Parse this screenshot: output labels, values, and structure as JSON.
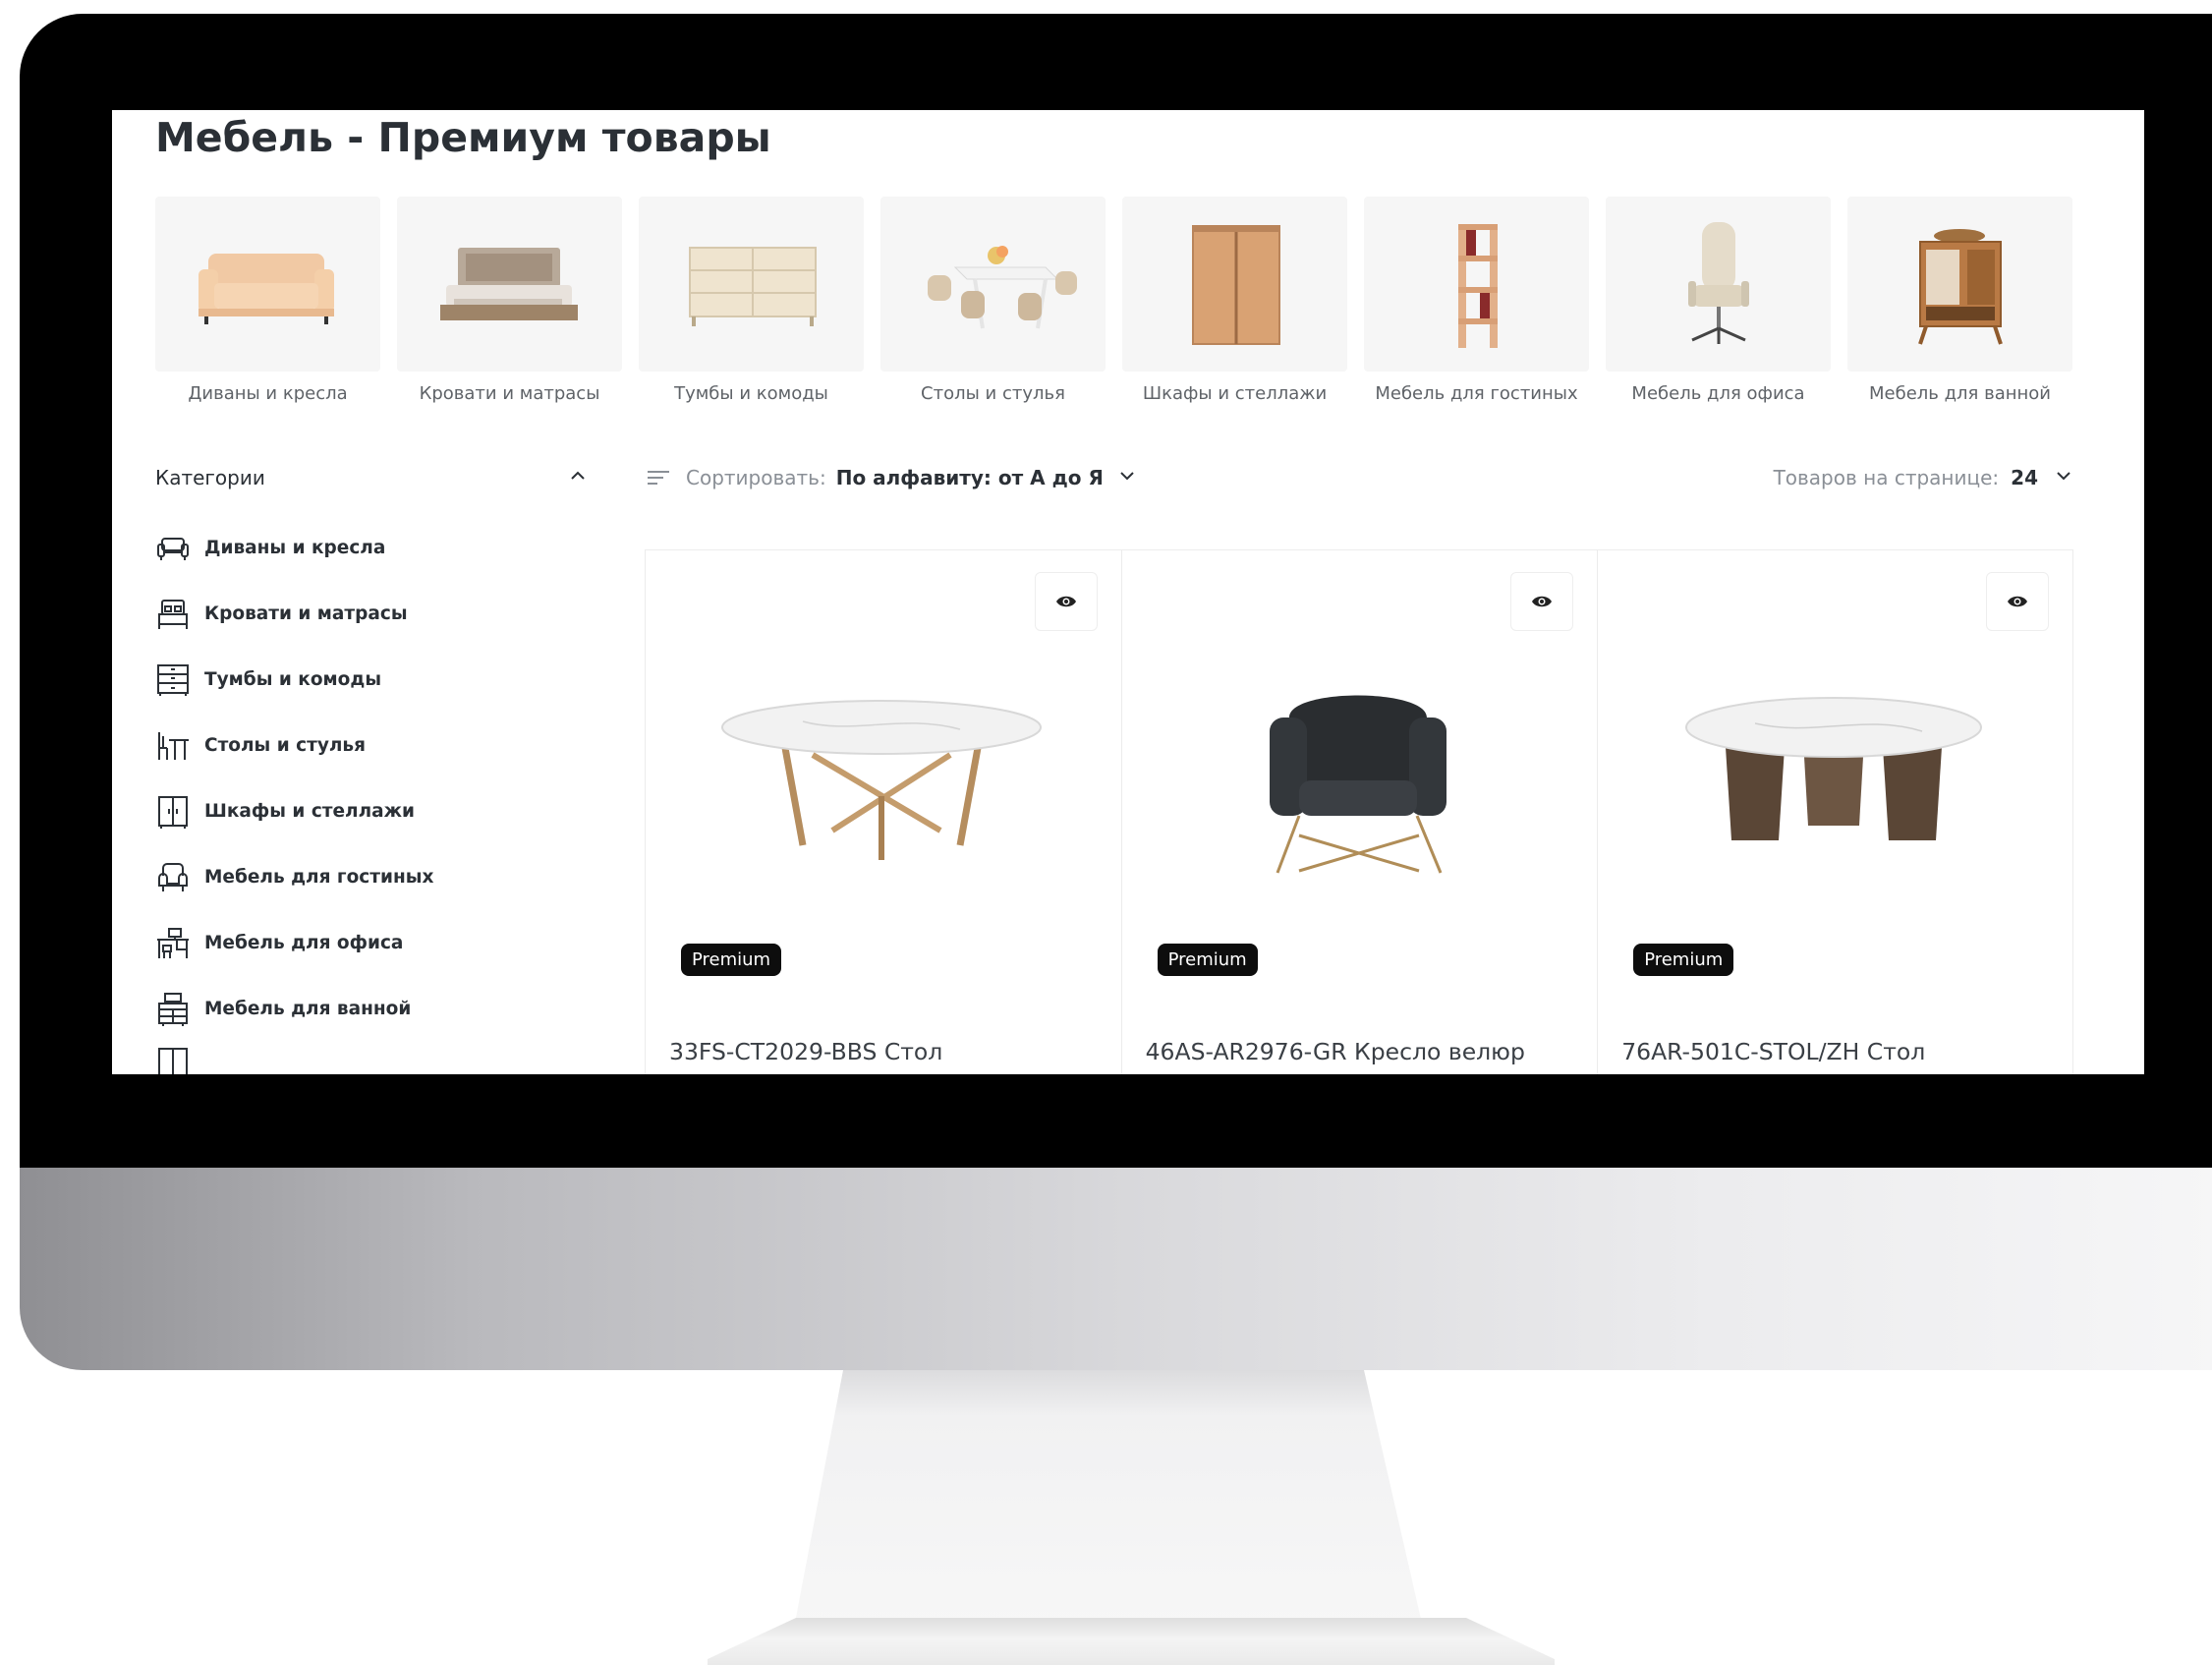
{
  "page": {
    "title": "Мебель - Премиум товары"
  },
  "tiles": [
    {
      "label": "Диваны и кресла",
      "icon": "sofa-icon"
    },
    {
      "label": "Кровати и матрасы",
      "icon": "bed-icon"
    },
    {
      "label": "Тумбы и комоды",
      "icon": "dresser-icon"
    },
    {
      "label": "Столы и стулья",
      "icon": "dining-set-icon"
    },
    {
      "label": "Шкафы и стеллажи",
      "icon": "wardrobe-icon"
    },
    {
      "label": "Мебель для гостиных",
      "icon": "bookshelf-icon"
    },
    {
      "label": "Мебель для офиса",
      "icon": "office-chair-icon"
    },
    {
      "label": "Мебель для ванной",
      "icon": "bathroom-cabinet-icon"
    }
  ],
  "sidebar": {
    "title": "Категории",
    "toggle_icon": "chevron-up-icon",
    "items": [
      {
        "label": "Диваны и кресла",
        "icon": "sofa-outline-icon"
      },
      {
        "label": "Кровати и матрасы",
        "icon": "bed-outline-icon"
      },
      {
        "label": "Тумбы и комоды",
        "icon": "dresser-outline-icon"
      },
      {
        "label": "Столы и стулья",
        "icon": "table-chair-outline-icon"
      },
      {
        "label": "Шкафы и стеллажи",
        "icon": "wardrobe-outline-icon"
      },
      {
        "label": "Мебель для гостиных",
        "icon": "armchair-outline-icon"
      },
      {
        "label": "Мебель для офиса",
        "icon": "desk-outline-icon"
      },
      {
        "label": "Мебель для ванной",
        "icon": "bathroom-outline-icon"
      }
    ]
  },
  "sort": {
    "label": "Сортировать:",
    "value": "По алфавиту: от А до Я",
    "icon": "sort-lines-icon"
  },
  "per_page": {
    "label": "Товаров на странице:",
    "value": "24"
  },
  "products": [
    {
      "name": "33FS-CT2029-BBS Стол",
      "badge": "Premium",
      "icon": "eye-icon",
      "image": "round-marble-table-gold-legs"
    },
    {
      "name": "46AS-AR2976-GR Кресло велюр",
      "badge": "Premium",
      "icon": "eye-icon",
      "image": "dark-velvet-armchair"
    },
    {
      "name": "76AR-501C-STOL/ZH Стол",
      "badge": "Premium",
      "icon": "eye-icon",
      "image": "round-marble-table-wood-base"
    }
  ],
  "colors": {
    "text_dark": "#2b3036",
    "text_muted": "#8a8f96",
    "badge_bg": "#0d0d0d",
    "tile_bg": "#f6f6f6"
  }
}
